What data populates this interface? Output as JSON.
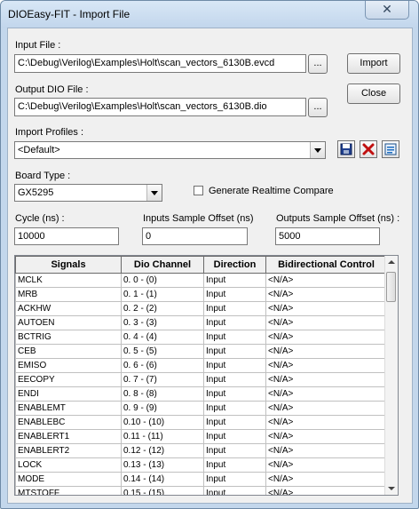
{
  "window": {
    "title": "DIOEasy-FIT - Import File",
    "close_glyph": "✕"
  },
  "input_file": {
    "label": "Input File :",
    "value": "C:\\Debug\\Verilog\\Examples\\Holt\\scan_vectors_6130B.evcd",
    "browse_label": "..."
  },
  "output_file": {
    "label": "Output DIO File :",
    "value": "C:\\Debug\\Verilog\\Examples\\Holt\\scan_vectors_6130B.dio",
    "browse_label": "..."
  },
  "buttons": {
    "import": "Import",
    "close": "Close"
  },
  "import_profiles": {
    "label": "Import Profiles :",
    "selected": "<Default>",
    "icons": [
      "save-icon",
      "delete-icon",
      "edit-icon"
    ]
  },
  "board_type": {
    "label": "Board Type :",
    "selected": "GX5295"
  },
  "realtime_compare": {
    "label": "Generate Realtime Compare",
    "checked": false
  },
  "cycle": {
    "label": "Cycle (ns) :",
    "value": "10000"
  },
  "inputs_offset": {
    "label": "Inputs Sample Offset (ns)",
    "value": "0"
  },
  "outputs_offset": {
    "label": "Outputs Sample Offset (ns) :",
    "value": "5000"
  },
  "table": {
    "headers": [
      "Signals",
      "Dio Channel",
      "Direction",
      "Bidirectional Control"
    ],
    "rows": [
      [
        "MCLK",
        "0. 0 - (0)",
        "Input",
        "<N/A>"
      ],
      [
        "MRB",
        "0. 1 - (1)",
        "Input",
        "<N/A>"
      ],
      [
        "ACKHW",
        "0. 2 - (2)",
        "Input",
        "<N/A>"
      ],
      [
        "AUTOEN",
        "0. 3 - (3)",
        "Input",
        "<N/A>"
      ],
      [
        "BCTRIG",
        "0. 4 - (4)",
        "Input",
        "<N/A>"
      ],
      [
        "CEB",
        "0. 5 - (5)",
        "Input",
        "<N/A>"
      ],
      [
        "EMISO",
        "0. 6 - (6)",
        "Input",
        "<N/A>"
      ],
      [
        "EECOPY",
        "0. 7 - (7)",
        "Input",
        "<N/A>"
      ],
      [
        "ENDI",
        "0. 8 - (8)",
        "Input",
        "<N/A>"
      ],
      [
        "ENABLEMT",
        "0. 9 - (9)",
        "Input",
        "<N/A>"
      ],
      [
        "ENABLEBC",
        "0.10 - (10)",
        "Input",
        "<N/A>"
      ],
      [
        "ENABLERT1",
        "0.11 - (11)",
        "Input",
        "<N/A>"
      ],
      [
        "ENABLERT2",
        "0.12 - (12)",
        "Input",
        "<N/A>"
      ],
      [
        "LOCK",
        "0.13 - (13)",
        "Input",
        "<N/A>"
      ],
      [
        "MODE",
        "0.14 - (14)",
        "Input",
        "<N/A>"
      ],
      [
        "MTSTOFF",
        "0.15 - (15)",
        "Input",
        "<N/A>"
      ]
    ]
  }
}
